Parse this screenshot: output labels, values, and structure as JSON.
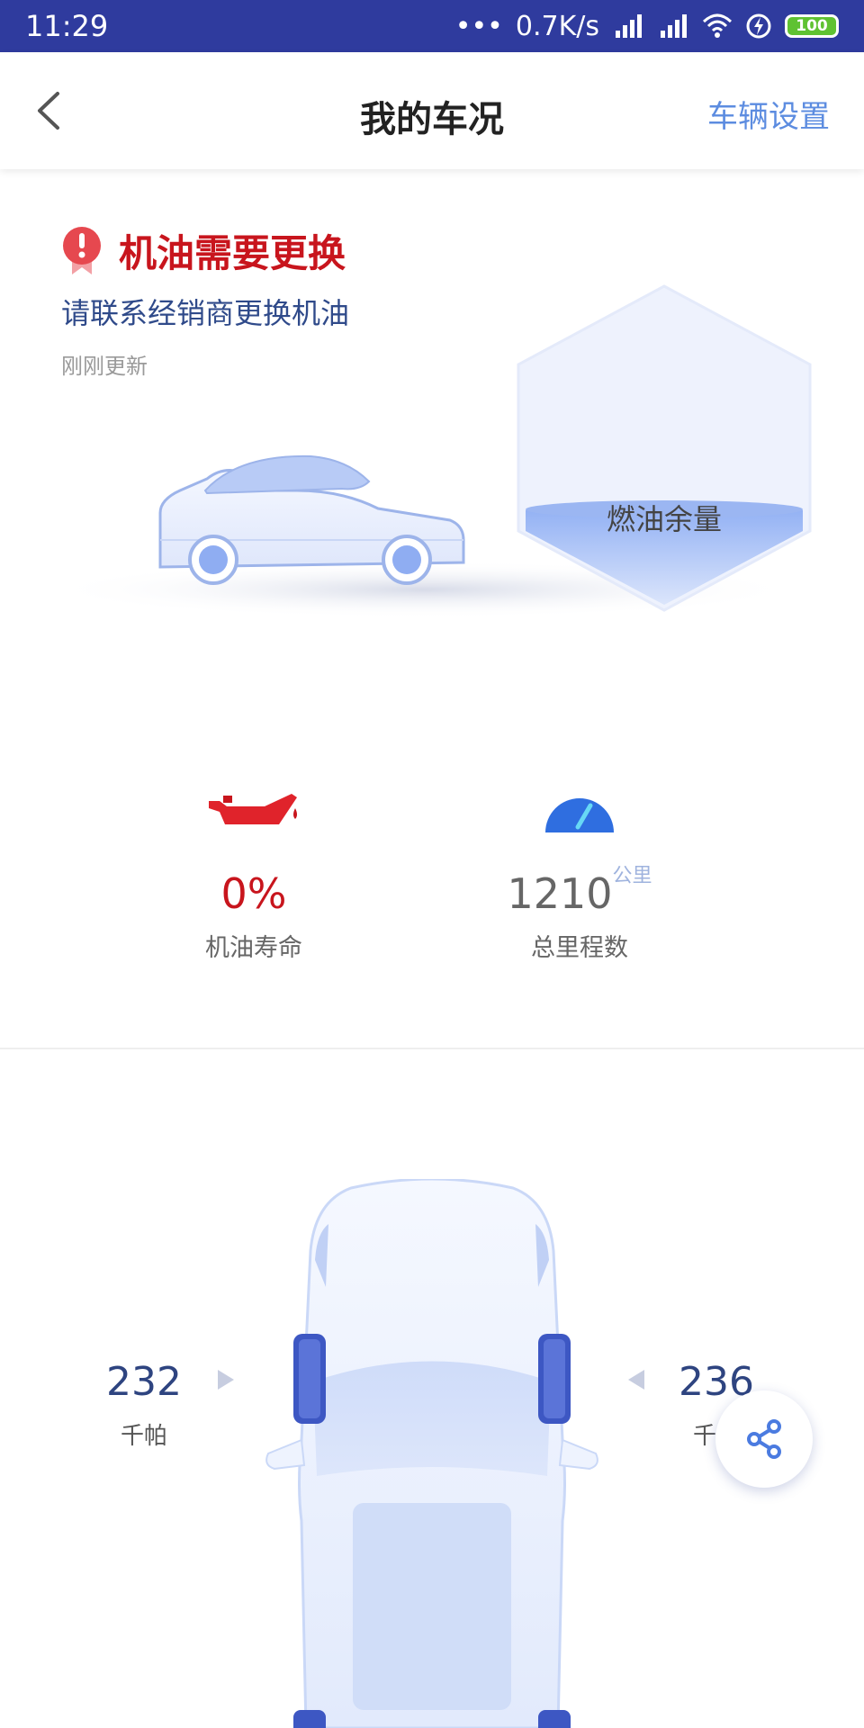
{
  "status_bar": {
    "time": "11:29",
    "speed": "0.7K/s",
    "battery": "100"
  },
  "nav": {
    "title": "我的车况",
    "action": "车辆设置"
  },
  "alert": {
    "title": "机油需要更换",
    "subtitle": "请联系经销商更换机油",
    "updated": "刚刚更新"
  },
  "fuel": {
    "label": "燃油余量",
    "level": 0.15
  },
  "stats": {
    "oil": {
      "value": "0%",
      "label": "机油寿命"
    },
    "mileage": {
      "value": "1210",
      "unit": "公里",
      "label": "总里程数"
    }
  },
  "tire_pressure": {
    "front_left": {
      "value": "232",
      "unit": "千帕"
    },
    "front_right": {
      "value": "236",
      "unit": "千帕"
    }
  },
  "colors": {
    "accent": "#5c8ce0",
    "warning": "#c8151d",
    "status_bar": "#2f3b9e"
  }
}
